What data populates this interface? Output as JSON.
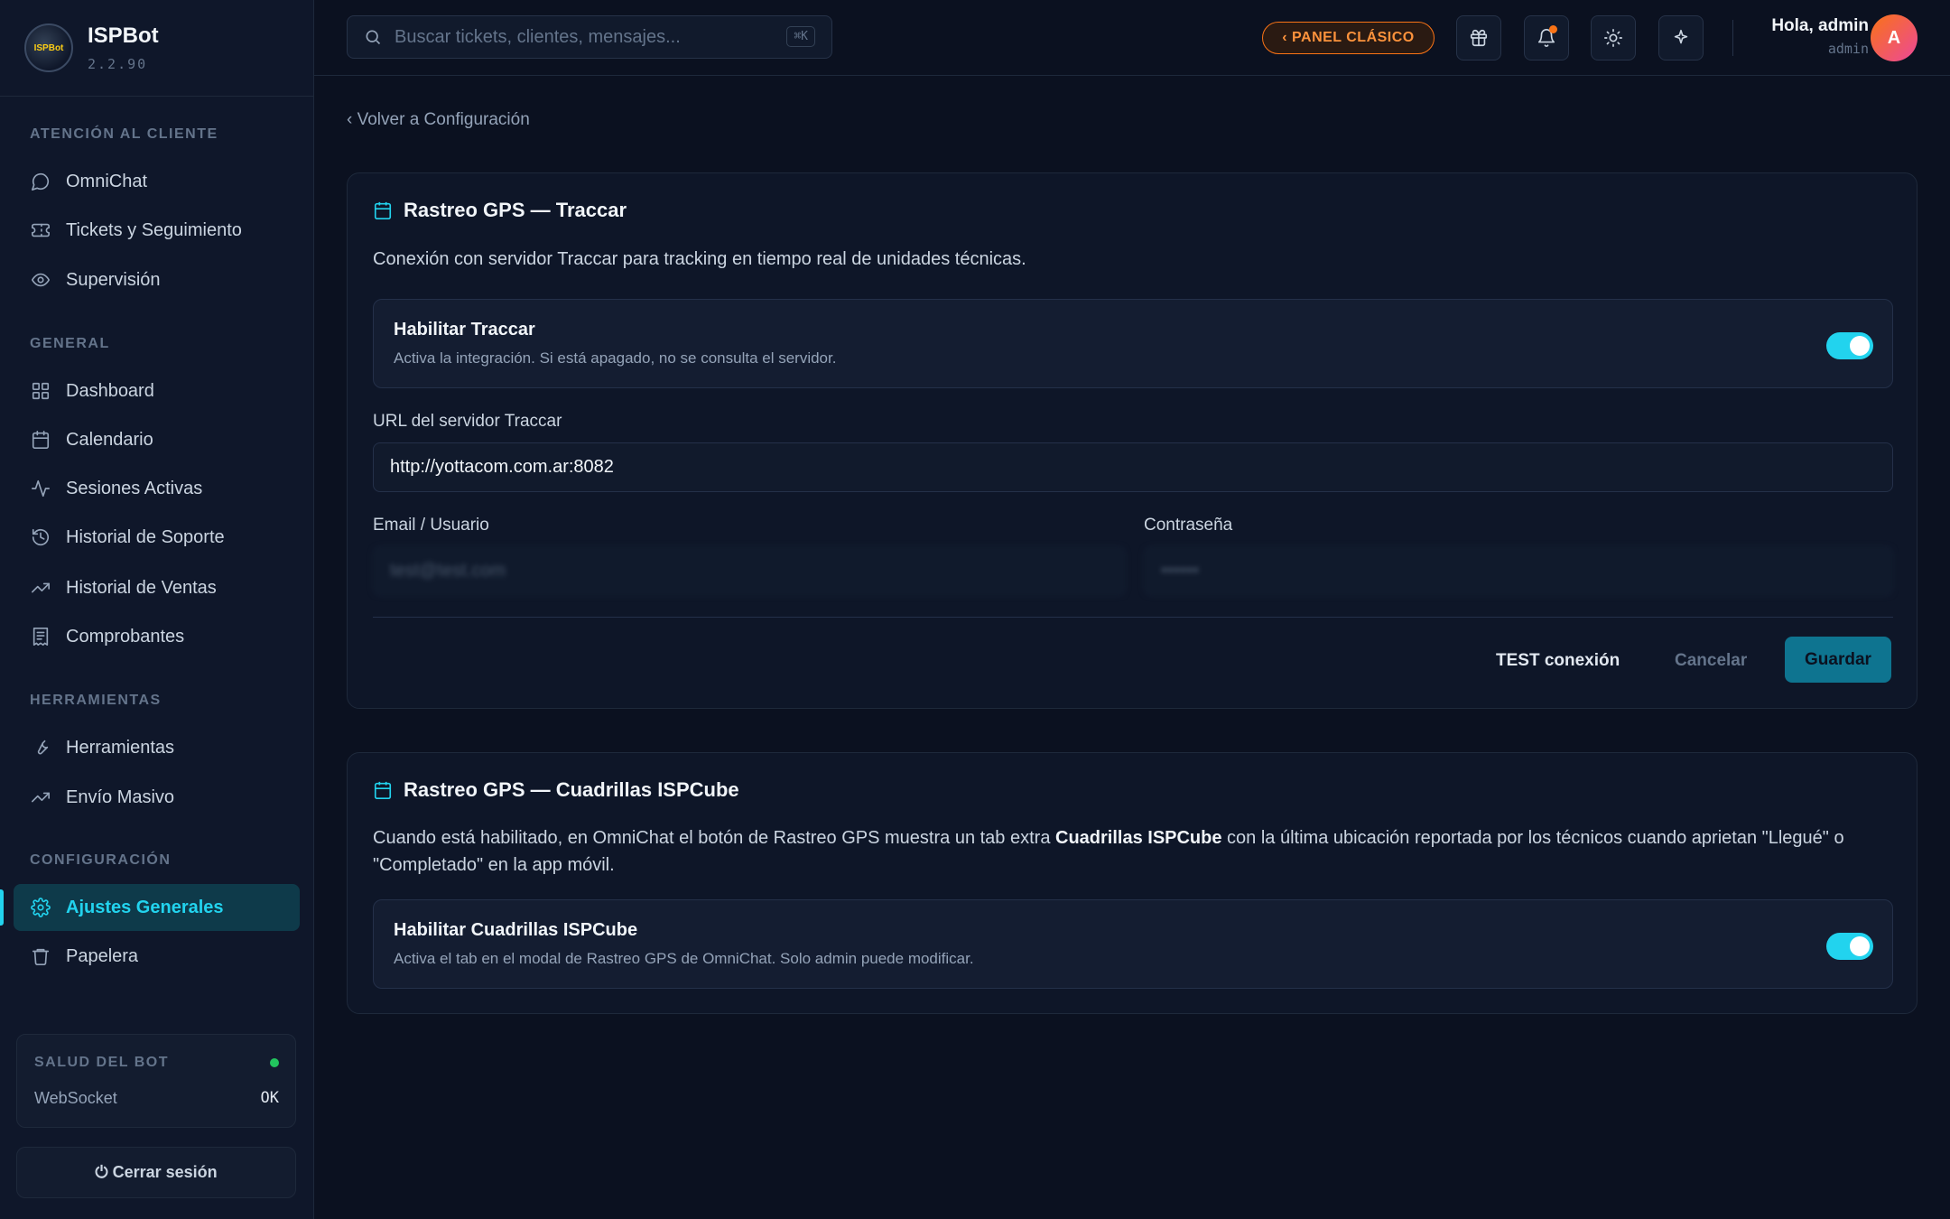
{
  "sidebar": {
    "app_name": "ISPBot",
    "version": "2.2.90",
    "logo_text": "ISPBot",
    "sections": [
      {
        "title": "ATENCIÓN AL CLIENTE",
        "items": [
          {
            "label": "OmniChat",
            "icon": "chat-icon"
          },
          {
            "label": "Tickets y Seguimiento",
            "icon": "ticket-icon"
          },
          {
            "label": "Supervisión",
            "icon": "eye-icon"
          }
        ]
      },
      {
        "title": "GENERAL",
        "items": [
          {
            "label": "Dashboard",
            "icon": "grid-icon"
          },
          {
            "label": "Calendario",
            "icon": "calendar-icon"
          },
          {
            "label": "Sesiones Activas",
            "icon": "activity-icon"
          },
          {
            "label": "Historial de Soporte",
            "icon": "history-icon"
          },
          {
            "label": "Historial de Ventas",
            "icon": "trending-icon"
          },
          {
            "label": "Comprobantes",
            "icon": "receipt-icon"
          }
        ]
      },
      {
        "title": "HERRAMIENTAS",
        "items": [
          {
            "label": "Herramientas",
            "icon": "wrench-icon"
          },
          {
            "label": "Envío Masivo",
            "icon": "trending-icon"
          }
        ]
      },
      {
        "title": "CONFIGURACIÓN",
        "items": [
          {
            "label": "Ajustes Generales",
            "icon": "gear-icon",
            "active": true
          },
          {
            "label": "Papelera",
            "icon": "trash-icon"
          }
        ]
      }
    ],
    "health": {
      "title": "SALUD DEL BOT",
      "row_label": "WebSocket",
      "row_value": "OK",
      "status_color": "#22c55e"
    },
    "logout_label": "⏻ Cerrar sesión"
  },
  "header": {
    "search_placeholder": "Buscar tickets, clientes, mensajes...",
    "search_shortcut": "⌘K",
    "panel_button": "‹ PANEL CLÁSICO",
    "greeting": "Hola, admin",
    "username": "admin",
    "avatar_letter": "A",
    "icons": [
      "gift-icon",
      "bell-icon",
      "sun-icon",
      "sparkle-icon"
    ]
  },
  "main": {
    "back_link": "‹ Volver a Configuración",
    "traccar": {
      "title": "Rastreo GPS — Traccar",
      "description": "Conexión con servidor Traccar para tracking en tiempo real de unidades técnicas.",
      "toggle_title": "Habilitar Traccar",
      "toggle_desc": "Activa la integración. Si está apagado, no se consulta el servidor.",
      "toggle_on": true,
      "url_label": "URL del servidor Traccar",
      "url_value": "http://yottacom.com.ar:8082",
      "email_label": "Email / Usuario",
      "email_value": "test@test.com",
      "password_label": "Contraseña",
      "password_value": "••••••",
      "test_button": "TEST conexión",
      "cancel_button": "Cancelar",
      "save_button": "Guardar"
    },
    "cuadrillas": {
      "title": "Rastreo GPS — Cuadrillas ISPCube",
      "desc_before": "Cuando está habilitado, en OmniChat el botón de Rastreo GPS muestra un tab extra ",
      "desc_bold": "Cuadrillas ISPCube",
      "desc_after": " con la última ubicación reportada por los técnicos cuando aprietan \"Llegué\" o \"Completado\" en la app móvil.",
      "toggle_title": "Habilitar Cuadrillas ISPCube",
      "toggle_desc": "Activa el tab en el modal de Rastreo GPS de OmniChat. Solo admin puede modificar.",
      "toggle_on": true
    }
  },
  "colors": {
    "accent": "#22d3ee",
    "warning": "#f97316",
    "background": "#0b1120"
  }
}
